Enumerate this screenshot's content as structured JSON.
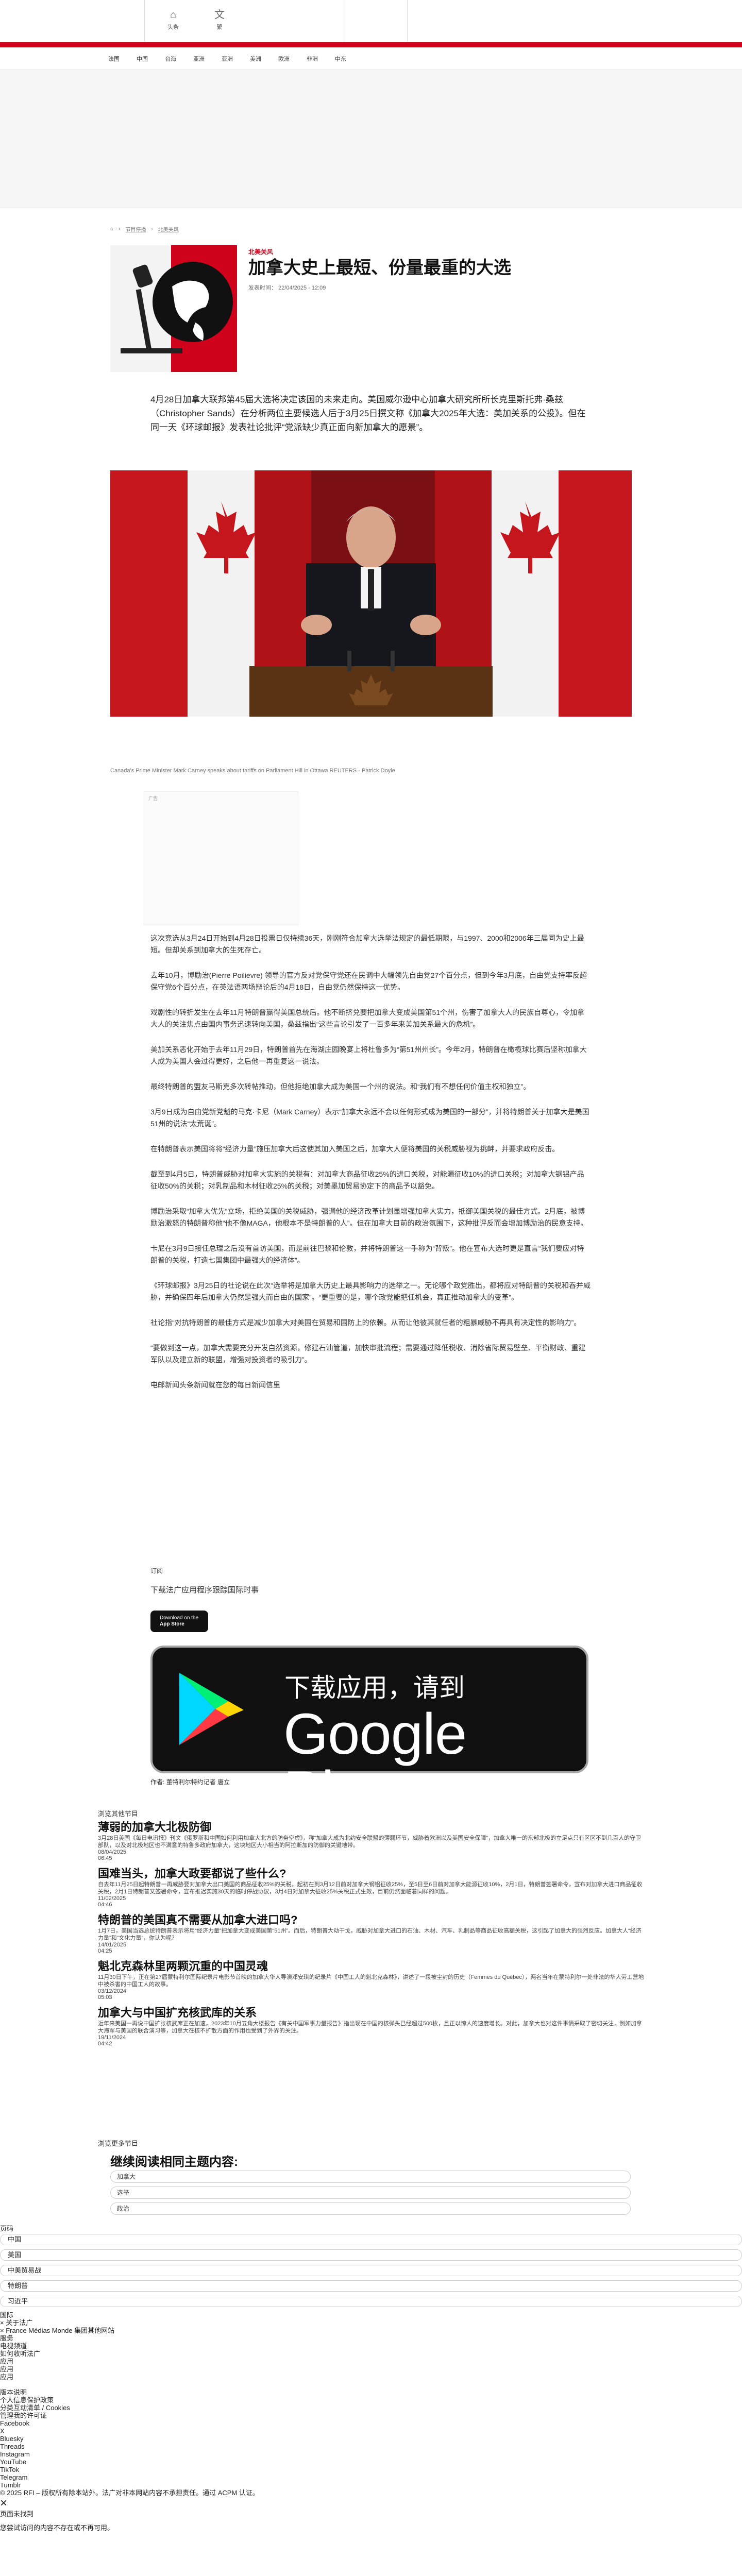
{
  "header": {
    "home_label": "头条",
    "lang_label": "繁",
    "nav": [
      "法国",
      "中国",
      "台海",
      "亚洲",
      "亚洲",
      "美洲",
      "欧洲",
      "非洲",
      "中东"
    ]
  },
  "breadcrumb": [
    "节目停播",
    "北美关风"
  ],
  "article": {
    "kicker": "北美关风",
    "title": "加拿大史上最短、份量最重的大选",
    "date": "发表时间：  22/04/2025 - 12:09",
    "lead": "4月28日加拿大联邦第45届大选将决定该国的未来走向。美国威尔逊中心加拿大研究所所长克里斯托弗·桑兹（Christopher Sands）在分析两位主要候选人后于3月25日撰文称《加拿大2025年大选：美加关系的公投》。但在同一天《环球邮报》发表社论批评“党派缺少真正面向新加拿大的愿景”。",
    "caption": "Canada's Prime Minister Mark Carney speaks about tariffs on Parliament Hill in Ottawa REUTERS - Patrick Doyle",
    "ad_label": "广告",
    "paragraphs": [
      "这次竞选从3月24日开始到4月28日投票日仅持续36天，刚刚符合加拿大选举法规定的最低期限，与1997、2000和2006年三届同为史上最短。但却关系到加拿大的生死存亡。",
      "去年10月，博励治(Pierre Poilievre) 领导的官方反对党保守党还在民调中大幅领先自由党27个百分点，但到今年3月底，自由党支持率反超保守党6个百分点，在英法语两场辩论后的4月18日，自由党仍然保持这一优势。",
      "戏剧性的转折发生在去年11月特朗普赢得美国总统后。他不断挤兑要把加拿大变成美国第51个州，伤害了加拿大人的民族自尊心，令加拿大人的关注焦点由国内事务迅速转向美国，桑兹指出“这些言论引发了一百多年来美加关系最大的危机”。",
      "美加关系恶化开始于去年11月29日，特朗普首先在海湖庄园晚宴上将杜鲁多为“第51州州长”。今年2月，特朗普在橄榄球比赛后坚称加拿大人成为美国人会过得更好，之后他一再重复这一说法。",
      "最终特朗普的盟友马斯克多次转帖推动，但他拒绝加拿大成为美国一个州的说法。和“我们有不想任何价值主权和独立”。",
      "3月9日成为自由党新党魁的马克·卡尼（Mark Carney）表示“加拿大永远不会以任何形式成为美国的一部分”，并将特朗普关于加拿大是美国51州的说法“太荒诞”。",
      "在特朗普表示美国将将“经济力量”施压加拿大后这使其加入美国之后，加拿大人便将美国的关税威胁视为挑衅，并要求政府反击。",
      "截至到4月5日，特朗普威胁对加拿大实施的关税有：对加拿大商品征收25%的进口关税，对能源征收10%的进口关税；对加拿大钢铝产品征收50%的关税；对乳制品和木材征收25%的关税；对美墨加贸易协定下的商品予以豁免。",
      "博励治采取“加拿大优先”立场，拒绝美国的关税威胁，强调他的经济改革计划显增强加拿大实力，抵御美国关税的最佳方式。2月底，被博励治激怒的特朗普称他“他不像MAGA，他根本不是特朗普的人”。但在加拿大目前的政治氛围下，这种批评反而会增加博励治的民意支持。",
      "卡尼在3月9日接任总理之后没有首访美国，而是前往巴黎和伦敦，并将特朗普这一手称为“背叛”。他在宣布大选时更是直言“我们要应对特朗普的关税，打造七国集团中最强大的经济体”。",
      "《环球邮报》3月25日的社论说在此次“选举将是加拿大历史上最具影响力的选举之一。无论哪个政党胜出，都将应对特朗普的关税和吞并威胁，并确保四年后加拿大仍然是强大而自由的国家”。“更重要的是，哪个政党能把任机会，真正推动加拿大的变革”。",
      "社论指“对抗特朗普的最佳方式是减少加拿大对美国在贸易和国防上的依赖。从而让他彼其就任者的粗暴威胁不再具有决定性的影响力”。",
      "“要做到这一点，加拿大需要充分开发自然资源，修建石油管道，加快审批流程；需要通过降低税收、消除省际贸易壁垒、平衡财政、重建军队以及建立新的联盟，增强对投资者的吸引力”。",
      "电邮新闻头条新闻就在您的每日新闻信里"
    ],
    "app": {
      "subscribe": "订阅",
      "download_text": "下载法广应用程序跟踪国际时事",
      "appstore_small": "Download on the",
      "appstore_big": "App Store",
      "gplay_line1": "下载应用，请到",
      "gplay_line2": "Google Play"
    },
    "author": "作者:   董特利尔特约记者 唐立"
  },
  "related": {
    "section_label": "浏览其他节目",
    "items": [
      {
        "title": "薄弱的加拿大北极防御",
        "summary": "3月28日美国《每日电讯报》刊文《俄罗斯和中国如何利用加拿大北方的防务空虚》，称“加拿大成为北约安全联盟的薄弱环节，威胁着欧洲以及美国安全保障”，加拿大唯一的东部北极的立足点只有区区不到几百人的守卫部队，以及对北极地区也不满意的特鲁多政府加拿大，这块地区大小相当的阿拉斯加的防御的关键地带。",
        "date": "08/04/2025",
        "time": "06:45"
      },
      {
        "title": "国难当头，加拿大政要都说了些什么?",
        "summary": "自去年11月25日起特朗普一再威胁要对加拿大出口美国的商品征收25%的关税，起初在到3月12日前对加拿大钢铝征收25%，至5日至6日前对加拿大能源征收10%，2月1日，特朗普签署命令，宣布对加拿大进口商品征收关税，2月1日特朗普又签署命令，宣布推迟实施30天的临时停战协议，3月4日对加拿大征收25%关税正式生效，目前仍然面临着同样的问题。",
        "date": "11/02/2025",
        "time": "04:46"
      },
      {
        "title": "特朗普的美国真不需要从加拿大进口吗?",
        "summary": "1月7日，美国当选总统特朗普表示将用“经济力量”把加拿大变成美国第“51州”。而后，特朗普大动干戈，威胁对加拿大进口的石油、木材、汽车、乳制品等商品征收高额关税，这引起了加拿大的强烈反应。加拿大人“经济力量”和“文化力量”，你认为呢？",
        "date": "14/01/2025",
        "time": "04:25"
      },
      {
        "title": "魁北克森林里两颗沉重的中国灵魂",
        "summary": "11月30日下午，正在第27届蒙特利尔国际纪录片电影节首映的加拿大华人导演邓安琪的纪录片《中国工人的魁北克森林》，讲述了一段被尘封的历史（Femmes du Québec），两名当年在蒙特利尔一处非法的华人劳工营地中被杀害的中国工人的故事。",
        "date": "03/12/2024",
        "time": "05:03"
      },
      {
        "title": "加拿大与中国扩充核武库的关系",
        "summary": "近年来美国一再说中国扩张核武库正在加速，2023年10月五角大楼报告《有关中国军事力量报告》指出现在中国的核弹头已经超过500枚，且正以惊人的速度增长。对此，加拿大也对这件事情采取了密切关注，例如加拿大海军与美国的联合演习等，加拿大在核不扩散方面的作用也受到了外界的关注。",
        "date": "19/11/2024",
        "time": "04:42"
      }
    ],
    "more_label": "浏览更多节目"
  },
  "themes": {
    "heading": "继续阅读相同主题内容:",
    "tags": [
      "加拿大",
      "选举",
      "政治"
    ]
  },
  "footer": {
    "lines_top": [
      "页码"
    ],
    "fields": [
      "中国",
      "美国",
      "中美贸易战",
      "特朗普",
      "习近平"
    ],
    "lines": [
      "国际",
      "× 关于法广",
      "× France Médias Monde 集团其他网站",
      "服务",
      "电视频道",
      "如何收听法广",
      "应用",
      "应用",
      "应用",
      "",
      "版本说明",
      "个人信息保护政策",
      "分类互动清单 / Cookies",
      "管理我的许可证",
      "Facebook",
      "X",
      "Bluesky",
      "Threads",
      "Instagram",
      "YouTube",
      "TikTok",
      "Telegram",
      "Tumblr",
      "© 2025 RFI – 版权所有除本站外。法广对非本网站内容不承担责任。通过 ACPM 认证。"
    ],
    "close_glyph": "×",
    "bottom_label": "页面未找到",
    "bottom_note": "您尝试访问的内容不存在或不再可用。"
  }
}
